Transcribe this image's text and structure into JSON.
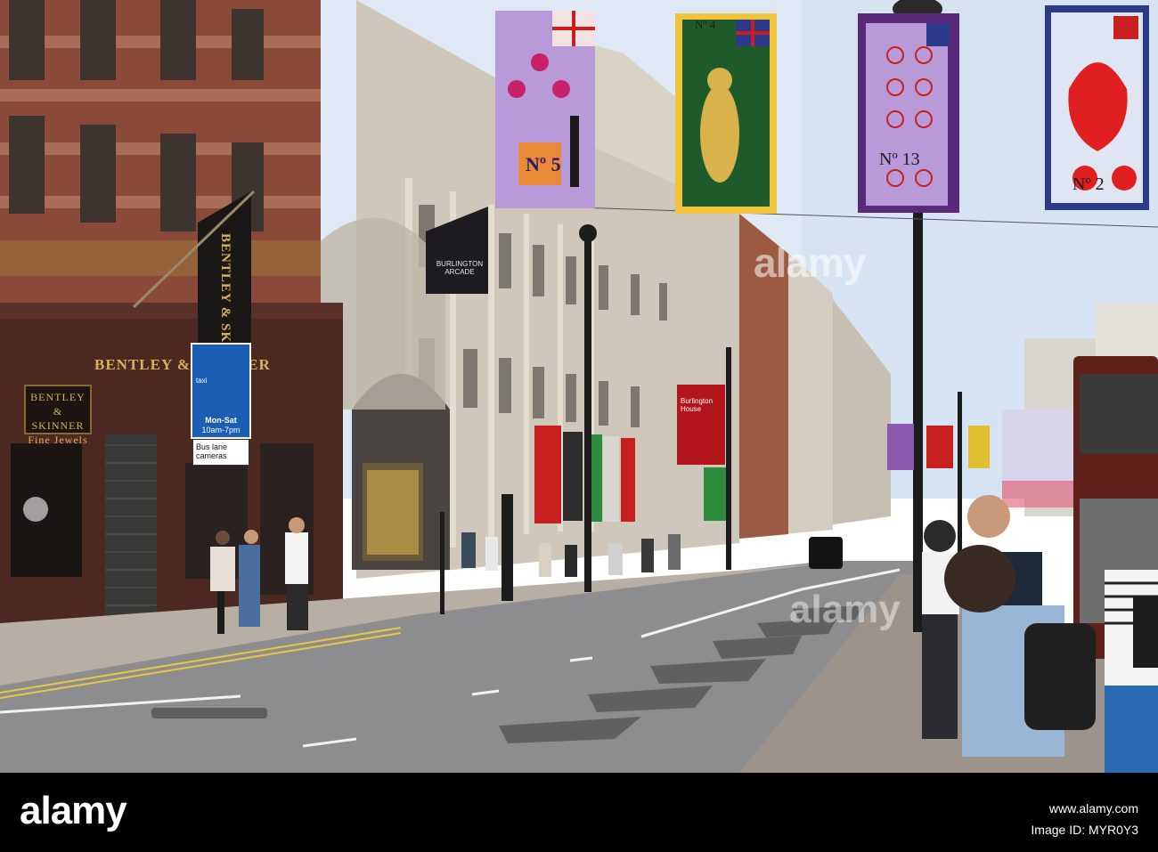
{
  "photo": {
    "shop_sign": "BENTLEY & SKINNER",
    "window_sign": [
      "BENTLEY",
      "& SKINNER",
      "Fine Jewels"
    ],
    "hanging_flag": "BENTLEY & SKINNER",
    "burlington_flag": "BURLINGTON ARCADE",
    "red_banner": "Burlington House",
    "bus_lane_sign": {
      "taxi": "taxi",
      "days": "Mon-Sat",
      "hours": "10am-7pm"
    },
    "camera_sign": "Bus lane cameras",
    "banners": [
      "Nº 5",
      "Nº 4",
      "Nº 13",
      "Nº 2"
    ],
    "watermark": "alamy",
    "colors": {
      "sky": "#dfe9f5",
      "brick": "#8a4a3a",
      "stone": "#c9c2b4",
      "road": "#8d8d8f",
      "pavement": "#b7aea4",
      "banner_purple": "#b89ad8",
      "banner_green": "#1f5a2a",
      "banner_red": "#c8201e"
    }
  },
  "credit": {
    "logo": "alamy",
    "image_id": "Image ID: MYR0Y3",
    "url": "www.alamy.com"
  }
}
